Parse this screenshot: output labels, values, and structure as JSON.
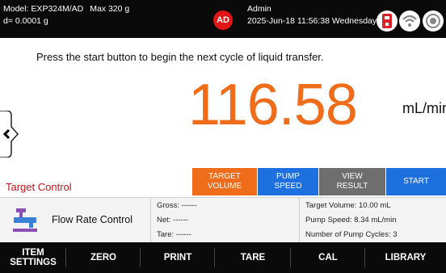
{
  "status_bar": {
    "model": "Model: EXP324M/AD",
    "max_capacity": "Max 320 g",
    "readability": "d= 0.0001 g",
    "user_initials": "AD",
    "user_name": "Admin",
    "datetime": "2025-Jun-18 11:56:38 Wednesday",
    "icons": [
      "usb-icon",
      "wifi-icon",
      "target-icon"
    ]
  },
  "message": "Press the start button to begin the next cycle of liquid transfer.",
  "reading": {
    "value": "116.58",
    "unit": "mL/min"
  },
  "target_control_label": "Target Control",
  "mode_buttons": [
    {
      "line1": "TARGET",
      "line2": "VOLUME",
      "color": "#ef6c1a"
    },
    {
      "line1": "PUMP",
      "line2": "SPEED",
      "color": "#1e6fe0"
    },
    {
      "line1": "VIEW",
      "line2": "RESULT",
      "color": "#6e6e6e"
    },
    {
      "line1": "START",
      "line2": "",
      "color": "#1e6fe0"
    }
  ],
  "info_panel": {
    "app_name": "Flow Rate Control",
    "gross": "Gross: ------",
    "net": "Net: ------",
    "tare": "Tare: ------",
    "target_volume": "Target Volume: 10.00 mL",
    "pump_speed": "Pump Speed: 8.34 mL/min",
    "pump_cycles": "Number of Pump Cycles: 3"
  },
  "function_keys": {
    "item_settings_1": "ITEM",
    "item_settings_2": "SETTINGS",
    "zero": "ZERO",
    "print": "PRINT",
    "tare": "TARE",
    "cal": "CAL",
    "library": "LIBRARY"
  },
  "colors": {
    "accent": "#ef6c1a",
    "primary": "#1e6fe0",
    "alert": "#c3161c",
    "bar": "#0a0a0a"
  }
}
